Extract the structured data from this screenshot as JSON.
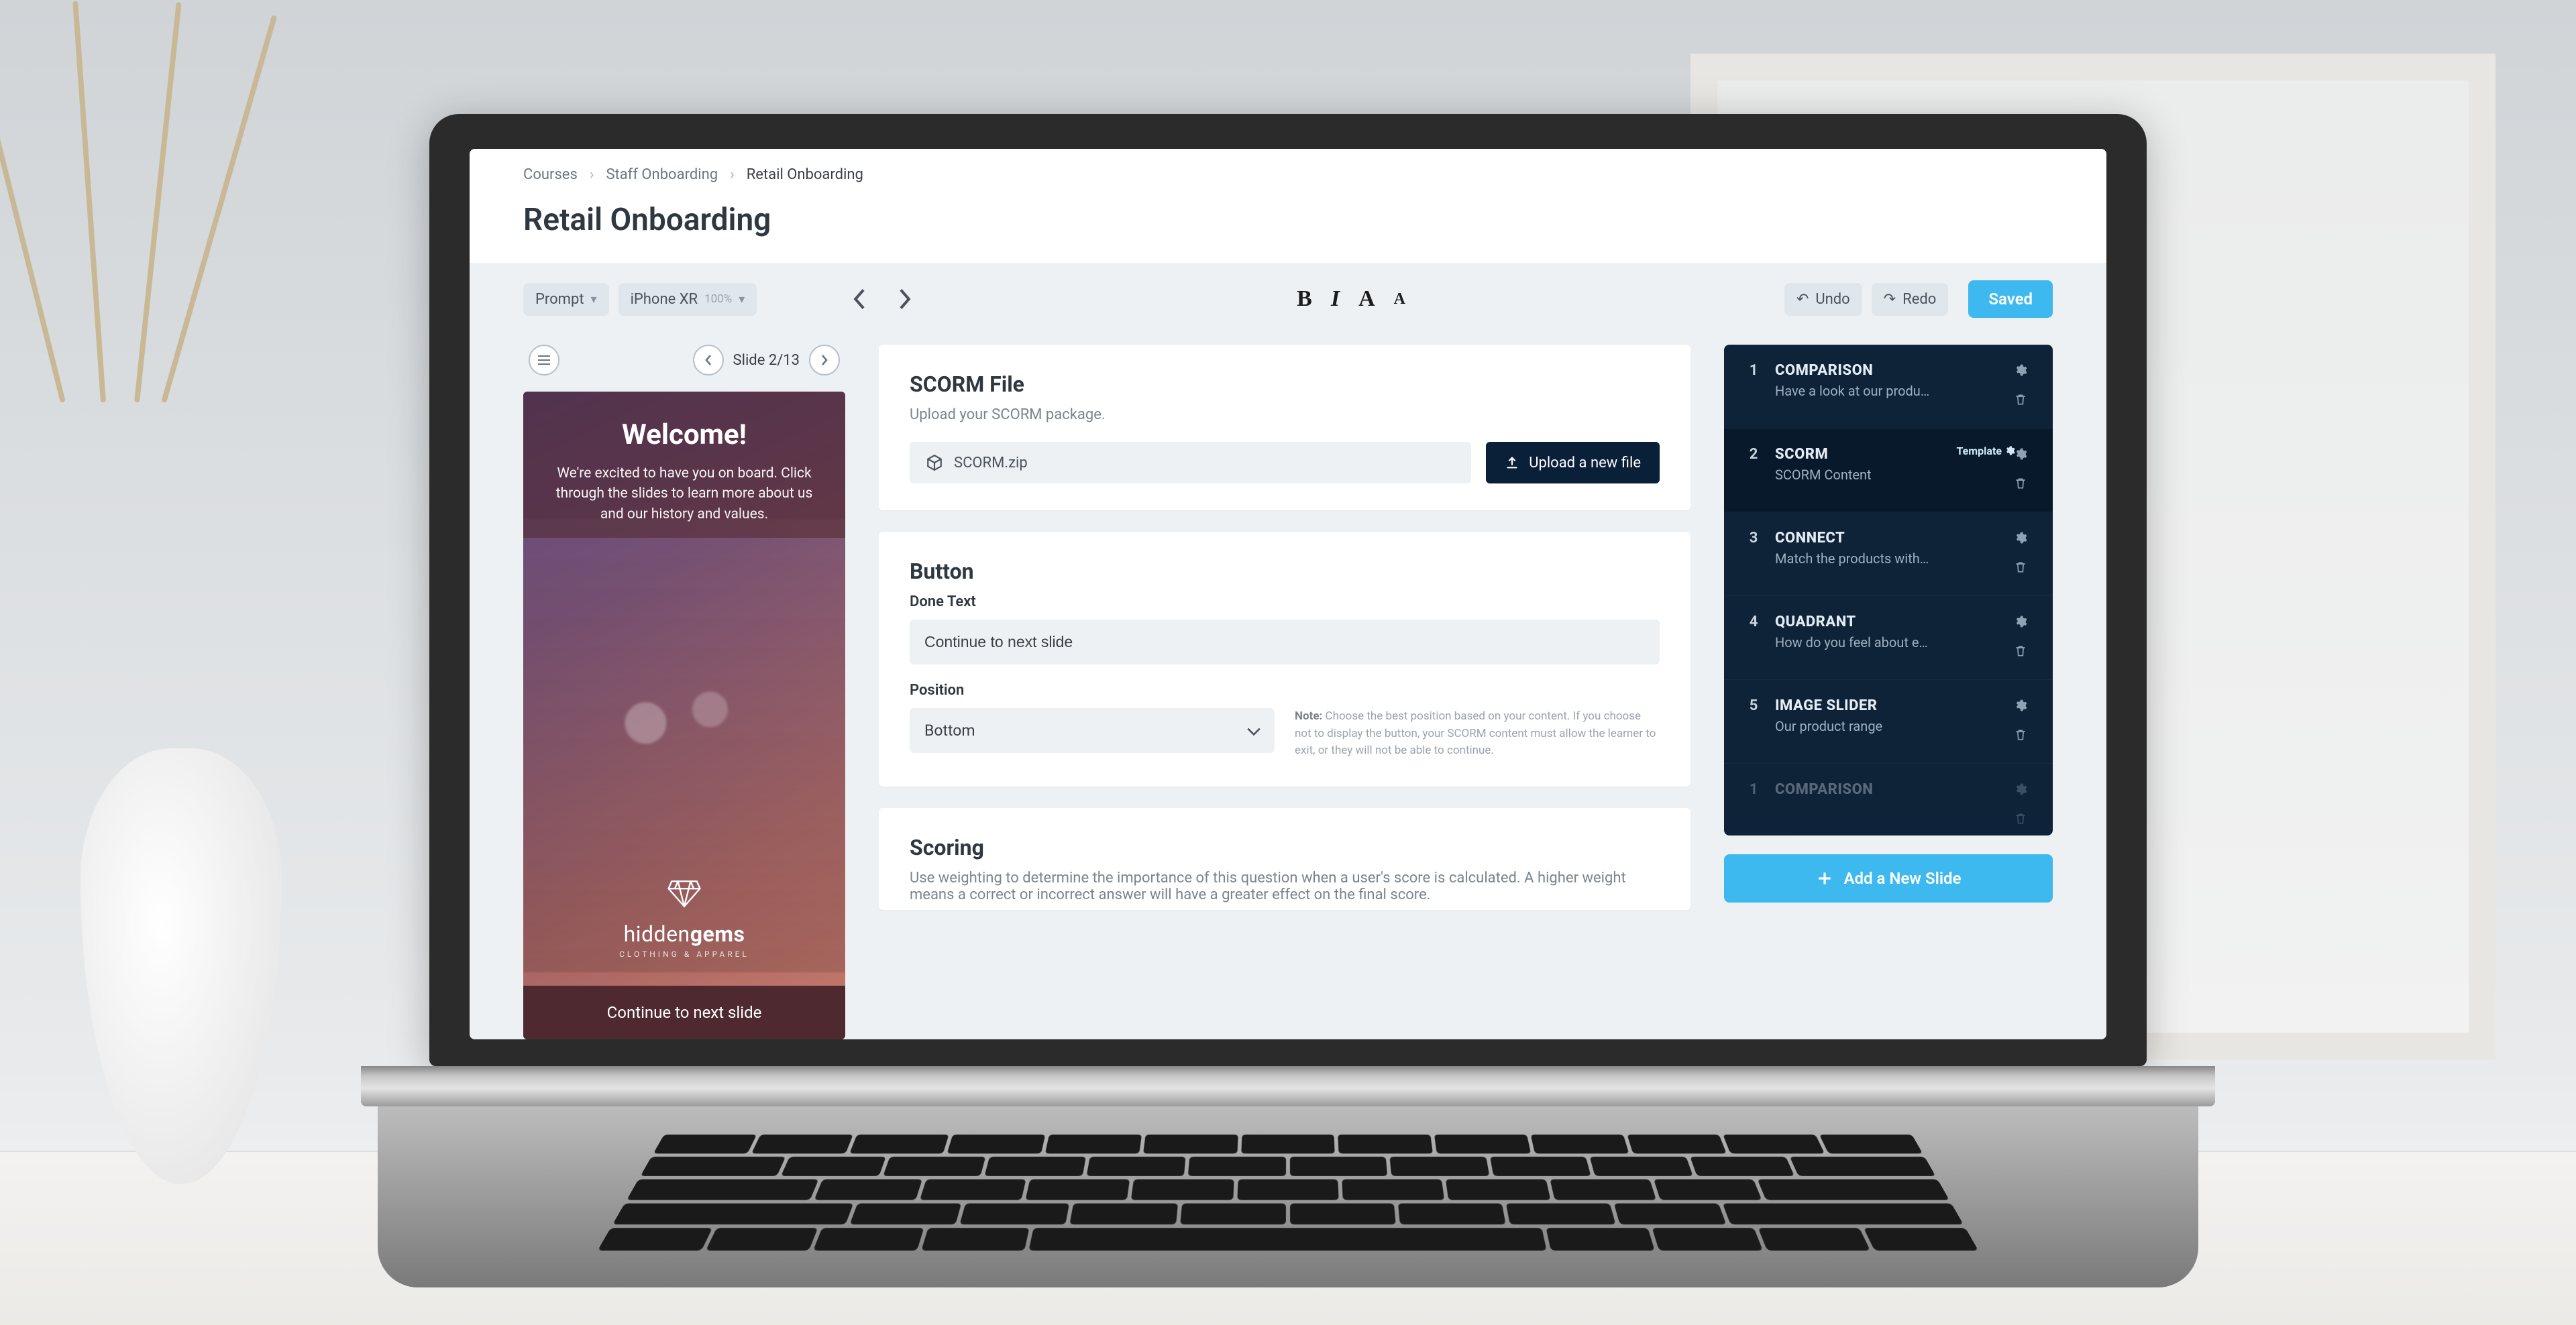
{
  "breadcrumb": {
    "root": "Courses",
    "mid": "Staff Onboarding",
    "current": "Retail Onboarding"
  },
  "page_title": "Retail Onboarding",
  "toolbar": {
    "prompt_label": "Prompt",
    "device_label": "iPhone XR",
    "zoom": "100%",
    "undo": "Undo",
    "redo": "Redo",
    "saved": "Saved"
  },
  "preview": {
    "slide_counter": "Slide 2/13",
    "welcome_title": "Welcome!",
    "welcome_body": "We're excited to have you on board. Click through the slides to learn more about us and our history and values.",
    "continue_label": "Continue to next slide",
    "brand_light": "hidden",
    "brand_bold": "gems",
    "brand_sub": "CLOTHING & APPAREL"
  },
  "scorm": {
    "card_title": "SCORM File",
    "subtitle": "Upload your SCORM package.",
    "file_name": "SCORM.zip",
    "upload_btn": "Upload a new file"
  },
  "button_cfg": {
    "card_title": "Button",
    "done_label": "Done Text",
    "done_value": "Continue to next slide",
    "position_label": "Position",
    "position_value": "Bottom",
    "note_prefix": "Note:",
    "note_body": "Choose the best position based on your content. If you choose not to display the button, your SCORM content must allow the learner to exit, or they will not be able to continue."
  },
  "scoring": {
    "card_title": "Scoring",
    "body": "Use weighting to determine the importance of this question when a user's score is calculated. A higher weight means a correct or incorrect answer will have a greater effect on the final score."
  },
  "slides": [
    {
      "num": "1",
      "title": "COMPARISON",
      "desc": "Have a look at our produ…"
    },
    {
      "num": "2",
      "title": "SCORM",
      "desc": "SCORM Content",
      "active": true,
      "badge": "Template"
    },
    {
      "num": "3",
      "title": "CONNECT",
      "desc": "Match the products with…"
    },
    {
      "num": "4",
      "title": "QUADRANT",
      "desc": "How do you feel about e…"
    },
    {
      "num": "5",
      "title": "IMAGE SLIDER",
      "desc": "Our product range"
    },
    {
      "num": "1",
      "title": "COMPARISON",
      "desc": "",
      "faded": true
    }
  ],
  "add_slide": "Add a New Slide"
}
